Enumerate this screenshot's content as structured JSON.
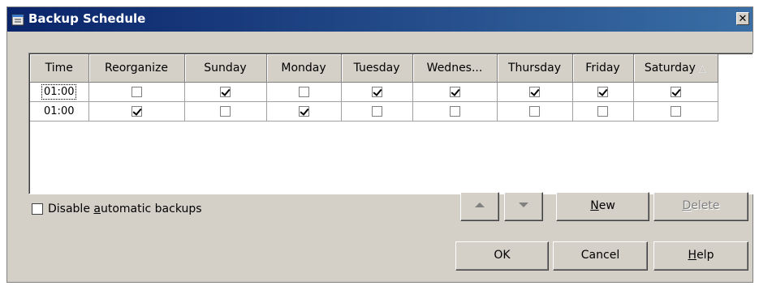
{
  "window": {
    "title": "Backup Schedule",
    "close_symbol": "✕"
  },
  "grid": {
    "columns": [
      "Time",
      "Reorganize",
      "Sunday",
      "Monday",
      "Tuesday",
      "Wednes...",
      "Thursday",
      "Friday",
      "Saturday"
    ],
    "sort_indicator": "△",
    "rows": [
      {
        "time": "01:00",
        "reorganize": false,
        "sunday": true,
        "monday": false,
        "tuesday": true,
        "wednesday": true,
        "thursday": true,
        "friday": true,
        "saturday": true
      },
      {
        "time": "01:00",
        "reorganize": true,
        "sunday": false,
        "monday": true,
        "tuesday": false,
        "wednesday": false,
        "thursday": false,
        "friday": false,
        "saturday": false
      }
    ]
  },
  "options": {
    "disable_label_pre": "Disable ",
    "disable_label_key": "a",
    "disable_label_post": "utomatic backups",
    "disable_checked": false
  },
  "buttons": {
    "new_key": "N",
    "new_rest": "ew",
    "delete_key": "D",
    "delete_rest": "elete",
    "ok": "OK",
    "cancel": "Cancel",
    "help_key": "H",
    "help_rest": "elp"
  },
  "colors": {
    "titlebar_start": "#0a246a",
    "titlebar_end": "#3a6ea5",
    "dialog_bg": "#d4d0c8"
  }
}
